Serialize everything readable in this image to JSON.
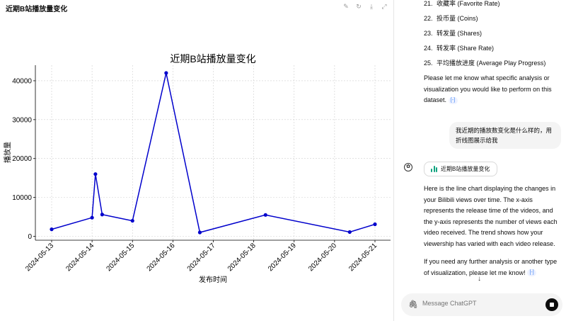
{
  "panel": {
    "title": "近期B站播放量变化",
    "tools": {
      "brush_icon": "brush-icon",
      "refresh_icon": "refresh-icon",
      "download_icon": "download-icon",
      "expand_icon": "expand-icon"
    }
  },
  "chart_data": {
    "type": "line",
    "title": "近期B站播放量变化",
    "xlabel": "发布时间",
    "ylabel": "播放量",
    "x_ticks": [
      "2024-05-13",
      "2024-05-14",
      "2024-05-15",
      "2024-05-16",
      "2024-05-17",
      "2024-05-18",
      "2024-05-19",
      "2024-05-20",
      "2024-05-21"
    ],
    "y_ticks": [
      0,
      10000,
      20000,
      30000,
      40000
    ],
    "ylim": [
      -1000,
      44000
    ],
    "grid": true,
    "color": "#0000cc",
    "points": [
      {
        "x": "2024-05-13 00:00",
        "y": 1800
      },
      {
        "x": "2024-05-14 00:00",
        "y": 4800
      },
      {
        "x": "2024-05-14 02:00",
        "y": 16000
      },
      {
        "x": "2024-05-14 06:00",
        "y": 5600
      },
      {
        "x": "2024-05-15 00:00",
        "y": 4000
      },
      {
        "x": "2024-05-15 20:00",
        "y": 42000
      },
      {
        "x": "2024-05-16 16:00",
        "y": 1000
      },
      {
        "x": "2024-05-18 07:00",
        "y": 5500
      },
      {
        "x": "2024-05-20 09:00",
        "y": 1100
      },
      {
        "x": "2024-05-21 00:00",
        "y": 3100
      }
    ]
  },
  "chat": {
    "list": [
      {
        "num": "21.",
        "label": "收藏率 (Favorite Rate)"
      },
      {
        "num": "22.",
        "label": "投币量 (Coins)"
      },
      {
        "num": "23.",
        "label": "转发量 (Shares)"
      },
      {
        "num": "24.",
        "label": "转发率 (Share Rate)"
      },
      {
        "num": "25.",
        "label": "平均播放进度 (Average Play Progress)"
      }
    ],
    "assistant_msg_1": "Please let me know what specific analysis or visualization you would like to perform on this dataset.",
    "user_msg": "我近期的播放数变化是什么样的，用折线图展示给我",
    "chip_label": "近期B站播放量变化",
    "assistant_msg_2": "Here is the line chart displaying the changes in your Bilibili views over time. The x-axis represents the release time of the videos, and the y-axis represents the number of views each video received. The trend shows how your viewership has varied with each video release.",
    "assistant_msg_3": "If you need any further analysis or another type of visualization, please let me know!",
    "cite_label": "[-]",
    "input_placeholder": "Message ChatGPT"
  }
}
